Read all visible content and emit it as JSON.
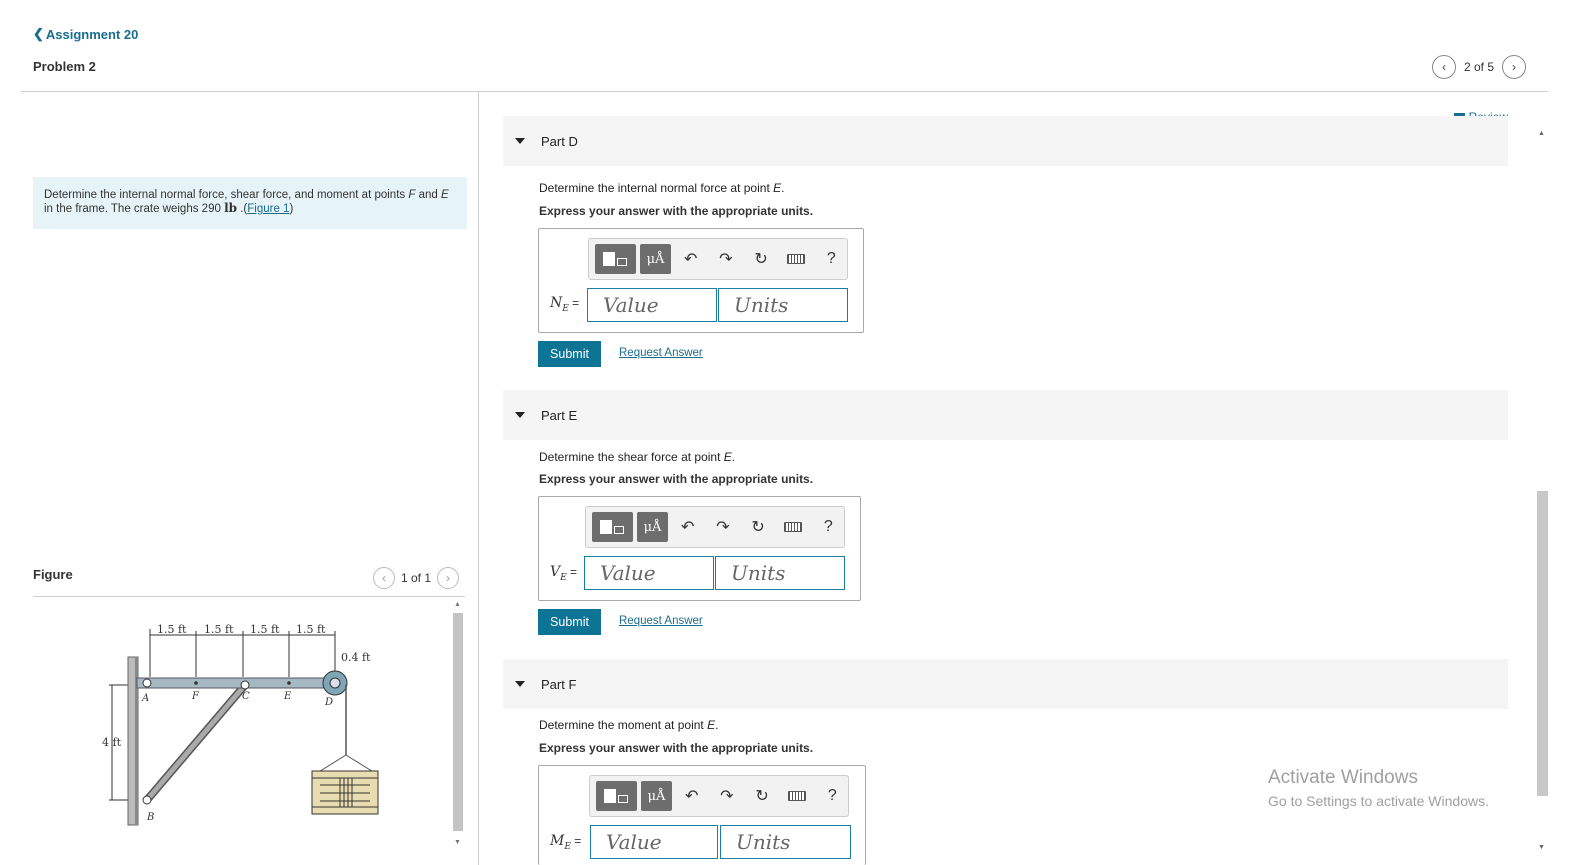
{
  "header": {
    "back_label": "Assignment 20",
    "problem_title": "Problem 2",
    "pager_text": "2 of 5"
  },
  "problem": {
    "text_part1": "Determine the internal normal force, shear force, and moment at points ",
    "point_f": "F",
    "text_and": " and ",
    "point_e": "E",
    "text_part2": " in the frame. The crate weighs 290 ",
    "unit": "lb",
    "text_part3": " .(",
    "figure_link": "Figure 1",
    "text_part4": ")"
  },
  "figure": {
    "label": "Figure",
    "pager_text": "1 of 1",
    "dims": [
      "1.5 ft",
      "1.5 ft",
      "1.5 ft",
      "1.5 ft"
    ],
    "radius_label": "0.4 ft",
    "height_label": "4 ft",
    "points": [
      "A",
      "F",
      "C",
      "E",
      "D",
      "B"
    ]
  },
  "review_label": "Review",
  "toolbar": {
    "units_symbol": "μÅ",
    "help": "?"
  },
  "parts": [
    {
      "title": "Part D",
      "question_prefix": "Determine the internal normal force at point ",
      "point": "E",
      "question_suffix": ".",
      "instruction": "Express your answer with the appropriate units.",
      "var_letter": "N",
      "var_sub": "E",
      "eq": " =",
      "value_placeholder": "Value",
      "units_placeholder": "Units",
      "submit": "Submit",
      "request": "Request Answer"
    },
    {
      "title": "Part E",
      "question_prefix": "Determine the shear force at point ",
      "point": "E",
      "question_suffix": ".",
      "instruction": "Express your answer with the appropriate units.",
      "var_letter": "V",
      "var_sub": "E",
      "eq": " =",
      "value_placeholder": "Value",
      "units_placeholder": "Units",
      "submit": "Submit",
      "request": "Request Answer"
    },
    {
      "title": "Part F",
      "question_prefix": "Determine the moment at point ",
      "point": "E",
      "question_suffix": ".",
      "instruction": "Express your answer with the appropriate units.",
      "var_letter": "M",
      "var_sub": "E",
      "eq": " =",
      "value_placeholder": "Value",
      "units_placeholder": "Units"
    }
  ],
  "watermark": {
    "title": "Activate Windows",
    "subtitle": "Go to Settings to activate Windows."
  },
  "colors": {
    "accent": "#0d7496",
    "link": "#1a6d8e",
    "problem_bg": "#e6f4f7",
    "part_header_bg": "#f5f5f5",
    "field_border": "#1a7ea3"
  }
}
